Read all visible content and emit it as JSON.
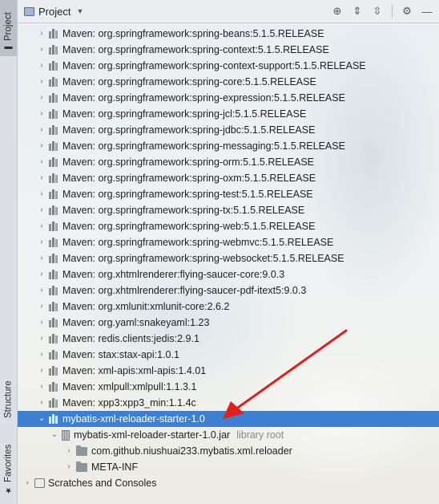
{
  "sidebar": {
    "project_tab": "Project",
    "structure_tab": "Structure",
    "favorites_tab": "Favorites"
  },
  "header": {
    "title": "Project",
    "icons": [
      "target-icon",
      "expand-all-icon",
      "collapse-all-icon",
      "gear-icon",
      "minimize-icon"
    ]
  },
  "tree": {
    "items": [
      {
        "label": "Maven: org.springframework:spring-beans:5.1.5.RELEASE"
      },
      {
        "label": "Maven: org.springframework:spring-context:5.1.5.RELEASE"
      },
      {
        "label": "Maven: org.springframework:spring-context-support:5.1.5.RELEASE"
      },
      {
        "label": "Maven: org.springframework:spring-core:5.1.5.RELEASE"
      },
      {
        "label": "Maven: org.springframework:spring-expression:5.1.5.RELEASE"
      },
      {
        "label": "Maven: org.springframework:spring-jcl:5.1.5.RELEASE"
      },
      {
        "label": "Maven: org.springframework:spring-jdbc:5.1.5.RELEASE"
      },
      {
        "label": "Maven: org.springframework:spring-messaging:5.1.5.RELEASE"
      },
      {
        "label": "Maven: org.springframework:spring-orm:5.1.5.RELEASE"
      },
      {
        "label": "Maven: org.springframework:spring-oxm:5.1.5.RELEASE"
      },
      {
        "label": "Maven: org.springframework:spring-test:5.1.5.RELEASE"
      },
      {
        "label": "Maven: org.springframework:spring-tx:5.1.5.RELEASE"
      },
      {
        "label": "Maven: org.springframework:spring-web:5.1.5.RELEASE"
      },
      {
        "label": "Maven: org.springframework:spring-webmvc:5.1.5.RELEASE"
      },
      {
        "label": "Maven: org.springframework:spring-websocket:5.1.5.RELEASE"
      },
      {
        "label": "Maven: org.xhtmlrenderer:flying-saucer-core:9.0.3"
      },
      {
        "label": "Maven: org.xhtmlrenderer:flying-saucer-pdf-itext5:9.0.3"
      },
      {
        "label": "Maven: org.xmlunit:xmlunit-core:2.6.2"
      },
      {
        "label": "Maven: org.yaml:snakeyaml:1.23"
      },
      {
        "label": "Maven: redis.clients:jedis:2.9.1"
      },
      {
        "label": "Maven: stax:stax-api:1.0.1"
      },
      {
        "label": "Maven: xml-apis:xml-apis:1.4.01"
      },
      {
        "label": "Maven: xmlpull:xmlpull:1.1.3.1"
      },
      {
        "label": "Maven: xpp3:xpp3_min:1.1.4c"
      }
    ],
    "selected_library": "mybatis-xml-reloader-starter-1.0",
    "jar": {
      "label": "mybatis-xml-reloader-starter-1.0.jar",
      "hint": "library root"
    },
    "packages": [
      {
        "label": "com.github.niushuai233.mybatis.xml.reloader"
      },
      {
        "label": "META-INF"
      }
    ],
    "scratches": "Scratches and Consoles"
  },
  "colors": {
    "selection": "#3d7fd1",
    "annotation_arrow": "#e02020"
  }
}
